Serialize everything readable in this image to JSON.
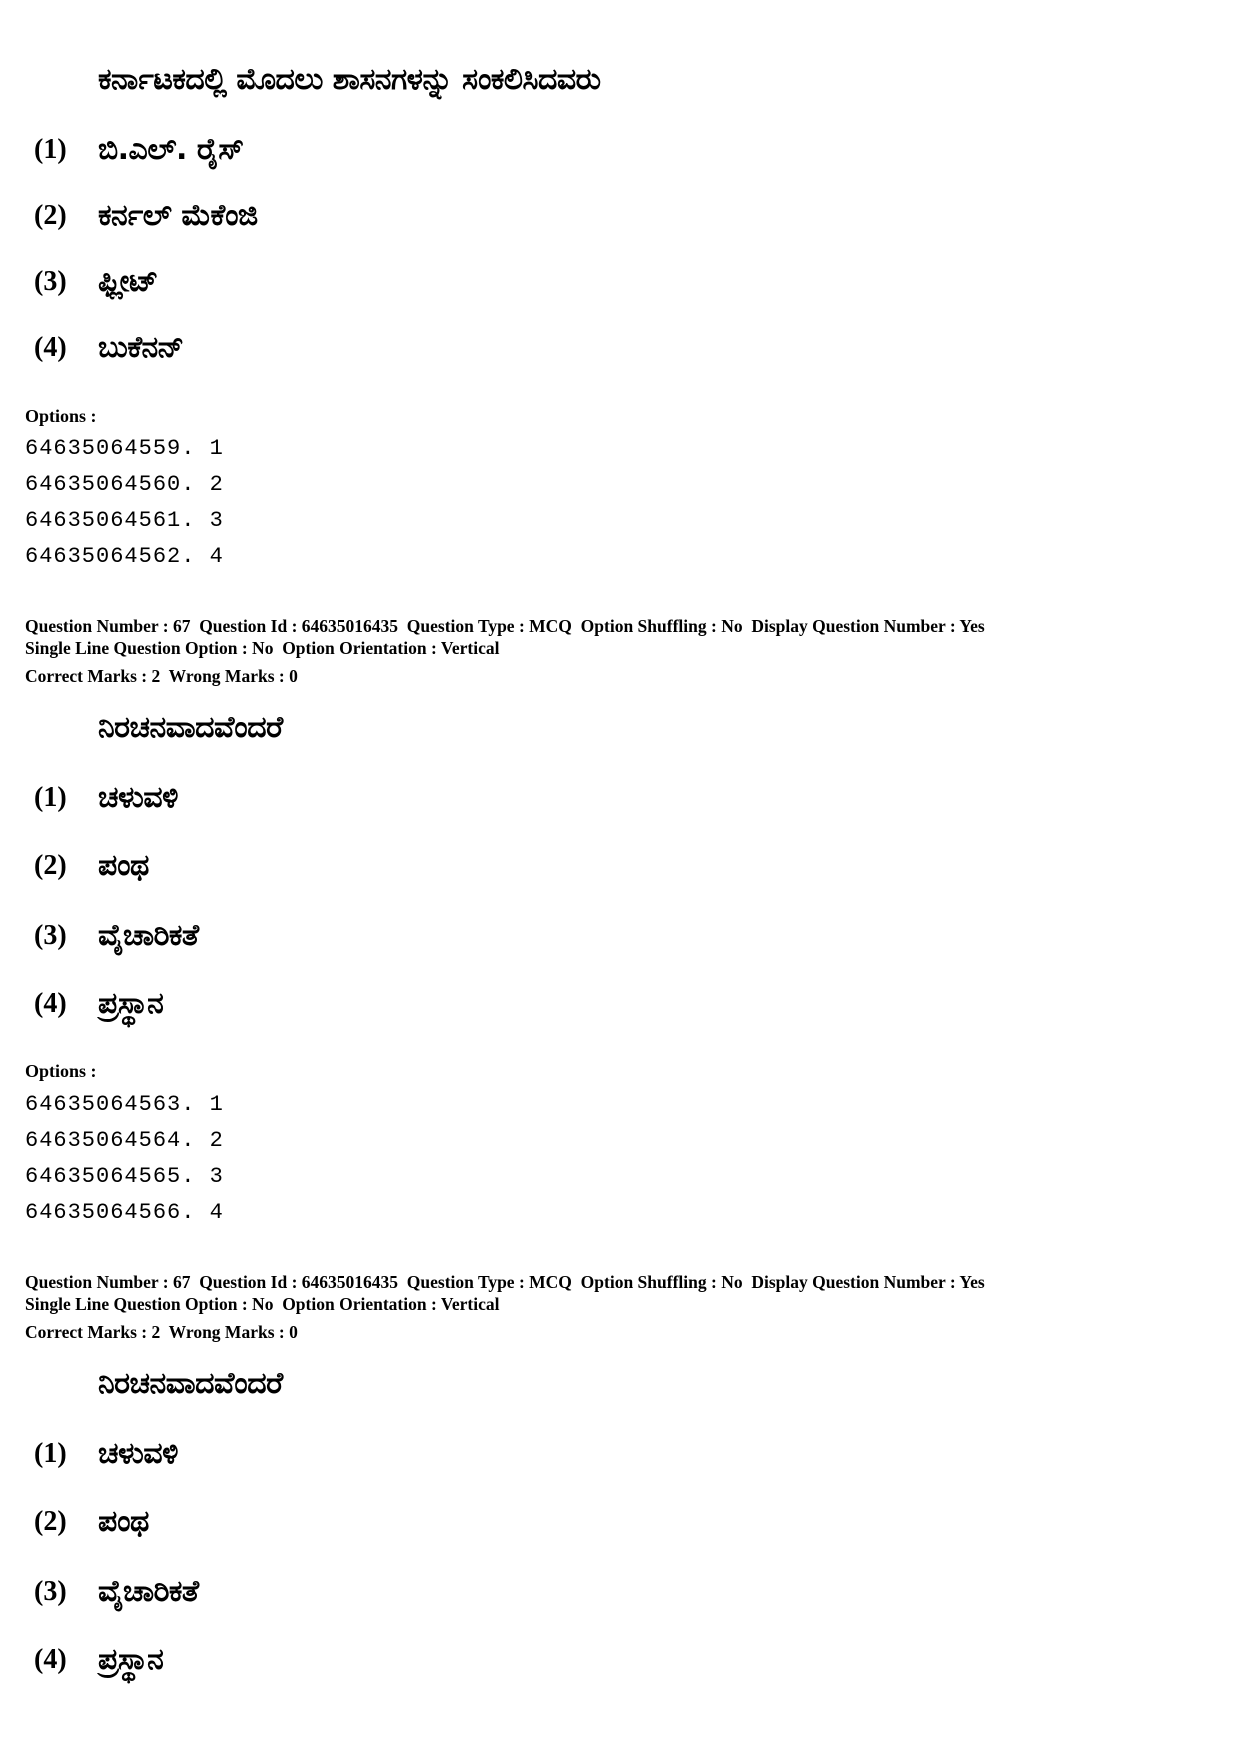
{
  "block1": {
    "question_text": "ಕರ್ನಾಟಕದಲ್ಲಿ ಮೊದಲು ಶಾಸನಗಳನ್ನು ಸಂಕಲಿಸಿದವರು",
    "choices": [
      {
        "num": "(1)",
        "text": "ಬಿ.ಎಲ್. ರೈಸ್"
      },
      {
        "num": "(2)",
        "text": "ಕರ್ನಲ್ ಮೆಕೆಂಜಿ"
      },
      {
        "num": "(3)",
        "text": "ಫ್ಲೀಟ್"
      },
      {
        "num": "(4)",
        "text": "ಬುಕೆನನ್"
      }
    ],
    "options_label": "Options :",
    "option_ids": [
      "64635064559. 1",
      "64635064560. 2",
      "64635064561. 3",
      "64635064562. 4"
    ]
  },
  "block2": {
    "meta_line1": "Question Number : 67  Question Id : 64635016435  Question Type : MCQ  Option Shuffling : No  Display Question Number : Yes",
    "meta_line2": "Single Line Question Option : No  Option Orientation : Vertical",
    "marks_line": "Correct Marks : 2  Wrong Marks : 0",
    "question_text": "ನಿರಚನವಾದವೆಂದರೆ",
    "choices": [
      {
        "num": "(1)",
        "text": "ಚಳುವಳಿ"
      },
      {
        "num": "(2)",
        "text": "ಪಂಥ"
      },
      {
        "num": "(3)",
        "text": "ವೈಚಾರಿಕತೆ"
      },
      {
        "num": "(4)",
        "text": "ಪ್ರಸ್ಥಾನ"
      }
    ],
    "options_label": "Options :",
    "option_ids": [
      "64635064563. 1",
      "64635064564. 2",
      "64635064565. 3",
      "64635064566. 4"
    ]
  },
  "block3": {
    "meta_line1": "Question Number : 67  Question Id : 64635016435  Question Type : MCQ  Option Shuffling : No  Display Question Number : Yes",
    "meta_line2": "Single Line Question Option : No  Option Orientation : Vertical",
    "marks_line": "Correct Marks : 2  Wrong Marks : 0",
    "question_text": "ನಿರಚನವಾದವೆಂದರೆ",
    "choices": [
      {
        "num": "(1)",
        "text": "ಚಳುವಳಿ"
      },
      {
        "num": "(2)",
        "text": "ಪಂಥ"
      },
      {
        "num": "(3)",
        "text": "ವೈಚಾರಿಕತೆ"
      },
      {
        "num": "(4)",
        "text": "ಪ್ರಸ್ಥಾನ"
      }
    ]
  }
}
